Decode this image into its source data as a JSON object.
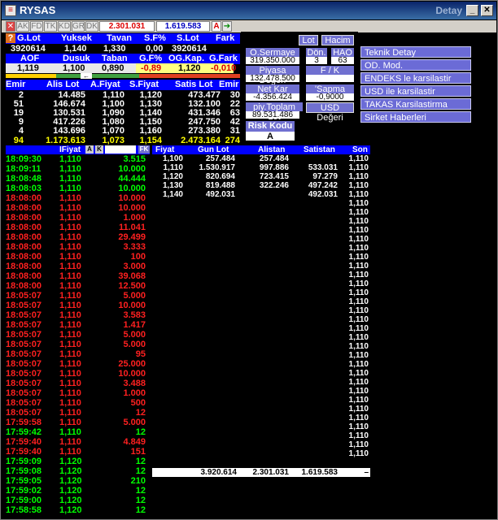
{
  "window": {
    "title": "RYSAS",
    "title_right": "Detay"
  },
  "toolbar": {
    "items": [
      "AK",
      "FD",
      "TK",
      "KD",
      "GR",
      "DK"
    ],
    "value_red": "2.301.031",
    "value_blue": "1.619.583",
    "a_label": "A"
  },
  "summary1": {
    "headers": [
      "G.Lot",
      "Yuksek",
      "Tavan",
      "S.F%",
      "S.Lot",
      "Fark"
    ],
    "values": [
      "3920614",
      "1,140",
      "1,330",
      "0,00",
      "3920614",
      ""
    ]
  },
  "summary2": {
    "headers": [
      "AOF",
      "Dusuk",
      "Taban",
      "G.F%",
      "OG.Kap.",
      "G.Fark"
    ],
    "values": [
      "1,119",
      "1,100",
      "0,890",
      "-0,89",
      "1,120",
      "-0,010"
    ]
  },
  "book": {
    "headers": [
      "Emir",
      "Alis Lot",
      "A.Fiyat",
      "S.Fiyat",
      "Satis Lot",
      "Emir"
    ],
    "rows": [
      [
        "2",
        "14.485",
        "1,110",
        "1,120",
        "473.477",
        "30"
      ],
      [
        "51",
        "146.674",
        "1,100",
        "1,130",
        "132.100",
        "22"
      ],
      [
        "19",
        "130.531",
        "1,090",
        "1,140",
        "431.346",
        "63"
      ],
      [
        "9",
        "417.226",
        "1,080",
        "1,150",
        "247.750",
        "42"
      ],
      [
        "4",
        "143.696",
        "1,070",
        "1,160",
        "273.380",
        "31"
      ]
    ],
    "total": [
      "94",
      "1.173.613",
      "1,073",
      "1,154",
      "2.473.164",
      "274"
    ]
  },
  "panel": {
    "lot": "Lot",
    "hacim": "Hacim",
    "o_sermaye": "O.Sermaye",
    "o_sermaye_val": "319.350.000",
    "don": "Dön.",
    "don_val": "3",
    "hao": "HAO",
    "hao_val": "63",
    "piyasa_degeri": "Piyasa Değeri",
    "piyasa_degeri_val": "132.478.500",
    "fk": "F / K",
    "fk_val": "",
    "net_kar": "Net Kar",
    "net_kar_val": "-4.356.424",
    "sapma": "'Sapma",
    "sapma_val": "-0,9000",
    "piy_toplam_lot": "piy.Toplam Lot",
    "piy_toplam_lot_val": "89.531.486",
    "usd_degeri": "USD Değeri",
    "risk_kodu": "Risk Kodu",
    "risk_kodu_val": "A"
  },
  "menu": [
    "Teknik Detay",
    "OD. Mod.",
    "ENDEKS le karsilastir",
    "USD ile karsilastir",
    "TAKAS Karsilastirma",
    "Sirket Haberleri"
  ],
  "trades_header": {
    "fiyat": "IFiyat",
    "a": "A",
    "k": "K",
    "fk": "FK"
  },
  "trades": [
    [
      "18:09:30",
      "1,110",
      "3.515",
      "g"
    ],
    [
      "18:09:11",
      "1,110",
      "10.000",
      "g"
    ],
    [
      "18:08:48",
      "1,110",
      "44.444",
      "g"
    ],
    [
      "18:08:03",
      "1,110",
      "10.000",
      "g"
    ],
    [
      "18:08:00",
      "1,110",
      "10.000",
      "r"
    ],
    [
      "18:08:00",
      "1,110",
      "10.000",
      "r"
    ],
    [
      "18:08:00",
      "1,110",
      "1.000",
      "r"
    ],
    [
      "18:08:00",
      "1,110",
      "11.041",
      "r"
    ],
    [
      "18:08:00",
      "1,110",
      "29.499",
      "r"
    ],
    [
      "18:08:00",
      "1,110",
      "3.333",
      "r"
    ],
    [
      "18:08:00",
      "1,110",
      "100",
      "r"
    ],
    [
      "18:08:00",
      "1,110",
      "3.000",
      "r"
    ],
    [
      "18:08:00",
      "1,110",
      "39.068",
      "r"
    ],
    [
      "18:08:00",
      "1,110",
      "12.500",
      "r"
    ],
    [
      "18:05:07",
      "1,110",
      "5.000",
      "r"
    ],
    [
      "18:05:07",
      "1,110",
      "10.000",
      "r"
    ],
    [
      "18:05:07",
      "1,110",
      "3.583",
      "r"
    ],
    [
      "18:05:07",
      "1,110",
      "1.417",
      "r"
    ],
    [
      "18:05:07",
      "1,110",
      "5.000",
      "r"
    ],
    [
      "18:05:07",
      "1,110",
      "5.000",
      "r"
    ],
    [
      "18:05:07",
      "1,110",
      "95",
      "r"
    ],
    [
      "18:05:07",
      "1,110",
      "25.000",
      "r"
    ],
    [
      "18:05:07",
      "1,110",
      "10.000",
      "r"
    ],
    [
      "18:05:07",
      "1,110",
      "3.488",
      "r"
    ],
    [
      "18:05:07",
      "1,110",
      "1.000",
      "r"
    ],
    [
      "18:05:07",
      "1,110",
      "500",
      "r"
    ],
    [
      "18:05:07",
      "1,110",
      "12",
      "r"
    ],
    [
      "17:59:58",
      "1,110",
      "5.000",
      "r"
    ],
    [
      "17:59:42",
      "1,110",
      "12",
      "g"
    ],
    [
      "17:59:40",
      "1,110",
      "4.849",
      "r"
    ],
    [
      "17:59:40",
      "1,110",
      "151",
      "r"
    ],
    [
      "17:59:09",
      "1,120",
      "12",
      "g"
    ],
    [
      "17:59:08",
      "1,120",
      "12",
      "g"
    ],
    [
      "17:59:05",
      "1,120",
      "210",
      "g"
    ],
    [
      "17:59:02",
      "1,120",
      "12",
      "g"
    ],
    [
      "17:59:00",
      "1,120",
      "12",
      "g"
    ],
    [
      "17:58:58",
      "1,120",
      "12",
      "g"
    ]
  ],
  "depth_header": [
    "Fiyat",
    "Gun Lot",
    "Alistan",
    "Satistan",
    "Son"
  ],
  "depth_rows": [
    [
      "1,100",
      "257.484",
      "257.484",
      "",
      ""
    ],
    [
      "1,110",
      "1.530.917",
      "997.886",
      "533.031",
      ""
    ],
    [
      "1,120",
      "820.694",
      "723.415",
      "97.279",
      ""
    ],
    [
      "1,130",
      "819.488",
      "322.246",
      "497.242",
      ""
    ],
    [
      "1,140",
      "492.031",
      "",
      "492.031",
      ""
    ]
  ],
  "son_column": "1,110",
  "depth_total": [
    "3.920.614",
    "2.301.031",
    "1.619.583",
    "–"
  ]
}
